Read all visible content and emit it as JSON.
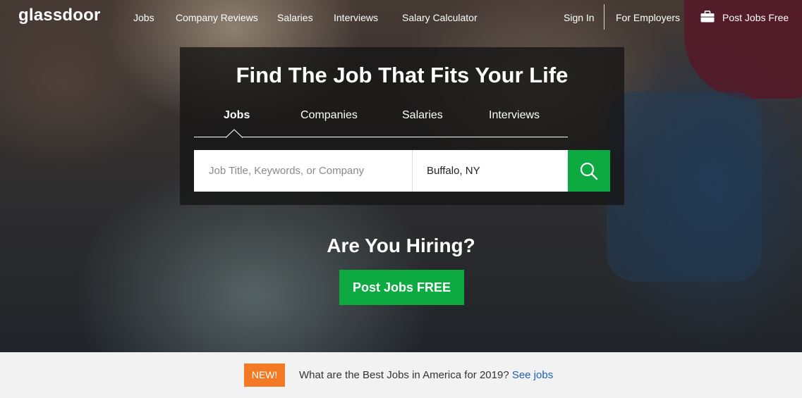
{
  "nav": {
    "logo": "glassdoor",
    "links": [
      "Jobs",
      "Company Reviews",
      "Salaries",
      "Interviews",
      "Salary Calculator"
    ],
    "sign_in": "Sign In",
    "for_employers": "For Employers",
    "post_jobs_free": "Post Jobs Free"
  },
  "search": {
    "title": "Find The Job That Fits Your Life",
    "tabs": [
      "Jobs",
      "Companies",
      "Salaries",
      "Interviews"
    ],
    "active_tab": "Jobs",
    "keyword_placeholder": "Job Title, Keywords, or Company",
    "location_value": "Buffalo, NY",
    "button_icon": "search-icon"
  },
  "hiring": {
    "title": "Are You Hiring?",
    "button_label": "Post Jobs FREE"
  },
  "promo": {
    "badge": "NEW!",
    "text": "What are the Best Jobs in America for 2019?",
    "link": "See jobs"
  },
  "colors": {
    "brand_green": "#0caa41",
    "badge_orange": "#f27a24",
    "link_blue": "#1861bf"
  }
}
